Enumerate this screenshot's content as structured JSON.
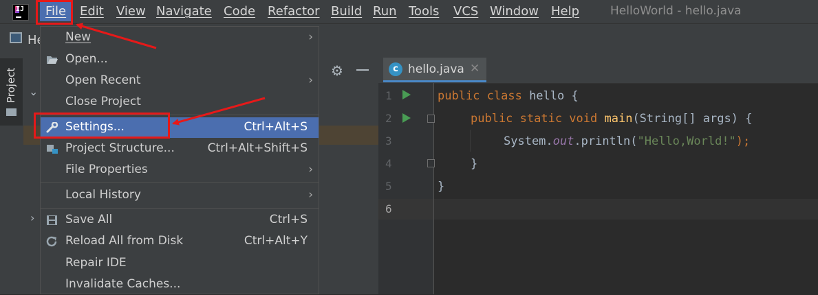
{
  "app": {
    "logo_text": "IJ",
    "window_title": "HelloWorld - hello.java"
  },
  "menubar": {
    "items": [
      "File",
      "Edit",
      "View",
      "Navigate",
      "Code",
      "Refactor",
      "Build",
      "Run",
      "Tools",
      "VCS",
      "Window",
      "Help"
    ]
  },
  "navbar": {
    "project_label": "He"
  },
  "sidebar": {
    "tab_label": "Project"
  },
  "file_menu": {
    "items": [
      {
        "label": "New",
        "shortcut": "",
        "submenu": true,
        "icon": ""
      },
      {
        "label": "Open...",
        "shortcut": "",
        "submenu": false,
        "icon": "folder-open-icon"
      },
      {
        "label": "Open Recent",
        "shortcut": "",
        "submenu": true,
        "icon": ""
      },
      {
        "label": "Close Project",
        "shortcut": "",
        "submenu": false,
        "icon": ""
      },
      {
        "label": "Settings...",
        "shortcut": "Ctrl+Alt+S",
        "submenu": false,
        "icon": "wrench-icon",
        "selected": true
      },
      {
        "label": "Project Structure...",
        "shortcut": "Ctrl+Alt+Shift+S",
        "submenu": false,
        "icon": "project-structure-icon"
      },
      {
        "label": "File Properties",
        "shortcut": "",
        "submenu": true,
        "icon": ""
      },
      {
        "label": "Local History",
        "shortcut": "",
        "submenu": true,
        "icon": ""
      },
      {
        "label": "Save All",
        "shortcut": "Ctrl+S",
        "submenu": false,
        "icon": "save-icon"
      },
      {
        "label": "Reload All from Disk",
        "shortcut": "Ctrl+Alt+Y",
        "submenu": false,
        "icon": "reload-icon"
      },
      {
        "label": "Repair IDE",
        "shortcut": "",
        "submenu": false,
        "icon": ""
      },
      {
        "label": "Invalidate Caches...",
        "shortcut": "",
        "submenu": false,
        "icon": ""
      }
    ]
  },
  "editor": {
    "tab_label": "hello.java",
    "tab_icon_letter": "c",
    "line_numbers": [
      "1",
      "2",
      "3",
      "4",
      "5",
      "6"
    ],
    "code": {
      "l1_kw": "public class",
      "l1_rest": " hello {",
      "l2_kw": "public static void",
      "l2_fn": "main",
      "l2_rest": "(String[] args) {",
      "l3_a": "System.",
      "l3_out": "out",
      "l3_b": ".println(",
      "l3_str": "\"Hello,World!\"",
      "l3_c": ");",
      "l4": "}",
      "l5": "}"
    }
  },
  "colors": {
    "menu_highlight": "#4b6eaf",
    "annotation_red": "#e61919",
    "keyword": "#cc7832",
    "string": "#6a8759"
  }
}
